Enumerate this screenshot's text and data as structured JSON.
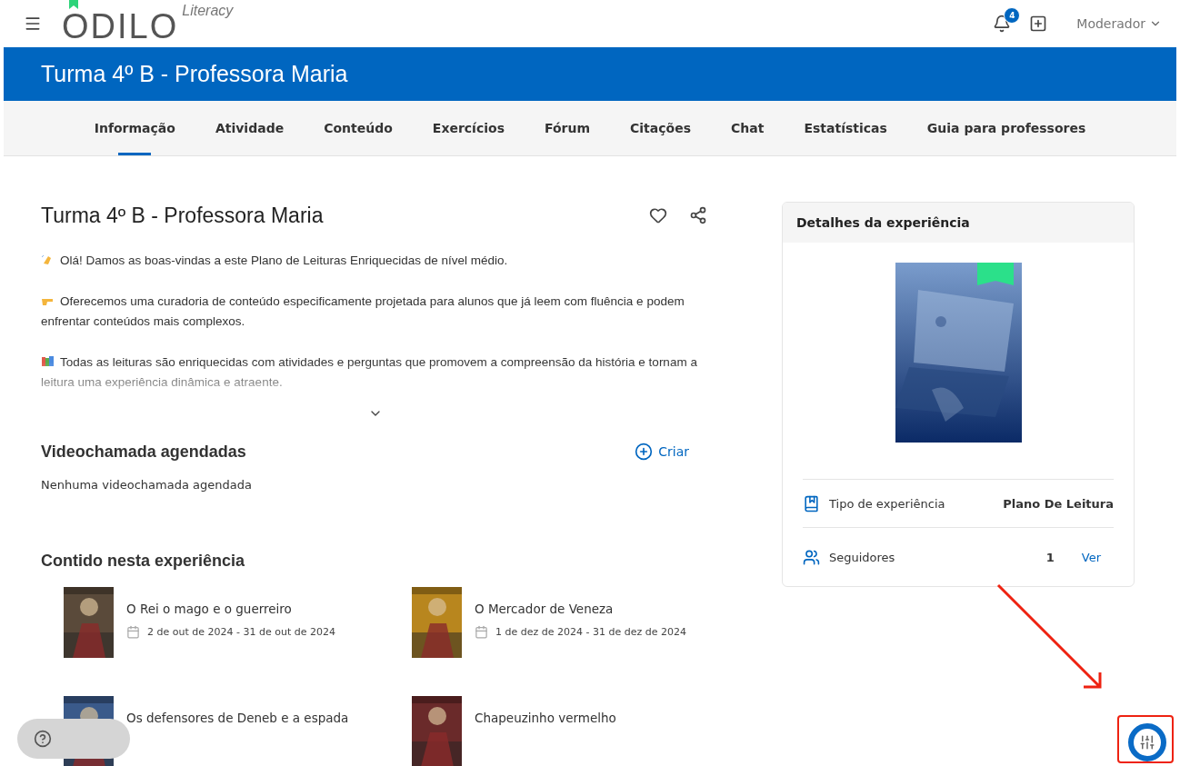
{
  "header": {
    "logo": {
      "name": "ODILO",
      "tagline": "Literacy"
    },
    "notifications": {
      "count": "4"
    },
    "user": "Moderador"
  },
  "banner": {
    "title": "Turma 4º B - Professora Maria"
  },
  "tabs": [
    {
      "label": "Informação",
      "selected": true
    },
    {
      "label": "Atividade",
      "selected": false
    },
    {
      "label": "Conteúdo",
      "selected": false
    },
    {
      "label": "Exercícios",
      "selected": false
    },
    {
      "label": "Fórum",
      "selected": false
    },
    {
      "label": "Citações",
      "selected": false
    },
    {
      "label": "Chat",
      "selected": false
    },
    {
      "label": "Estatísticas",
      "selected": false
    },
    {
      "label": "Guia para professores",
      "selected": false
    }
  ],
  "main": {
    "title": "Turma 4º B - Professora Maria",
    "description": {
      "expanded": false,
      "paragraphs": [
        {
          "text": "Olá! Damos as boas-vindas a este Plano de Leituras Enriquecidas de nível médio."
        },
        {
          "text": "Oferecemos uma curadoria de conteúdo especificamente projetada para alunos que já leem com fluência e podem enfrentar conteúdos mais complexos."
        },
        {
          "text": "Todas as leituras são enriquecidas com atividades e perguntas que promovem a compreensão da história e tornam a leitura uma experiência dinâmica e atraente."
        }
      ]
    },
    "videocalls": {
      "title": "Videochamada agendadas",
      "action": "Criar",
      "empty": "Nenhuma videochamada agendada"
    },
    "contents": {
      "title": "Contido nesta experiência",
      "items": [
        {
          "title": "O Rei o mago e o guerreiro",
          "dates": "2 de out de 2024 - 31 de out de 2024"
        },
        {
          "title": "O Mercador de Veneza",
          "dates": "1 de dez de 2024 - 31 de dez de 2024"
        },
        {
          "title": "Os defensores de Deneb e a espada"
        },
        {
          "title": "Chapeuzinho vermelho"
        }
      ]
    }
  },
  "sidebar": {
    "title": "Detalhes da experiência",
    "rows": [
      {
        "kind": "type",
        "label": "Tipo de experiência",
        "value": "Plano De Leitura"
      },
      {
        "kind": "followers",
        "label": "Seguidores",
        "value": "1",
        "link": "Ver"
      }
    ]
  }
}
